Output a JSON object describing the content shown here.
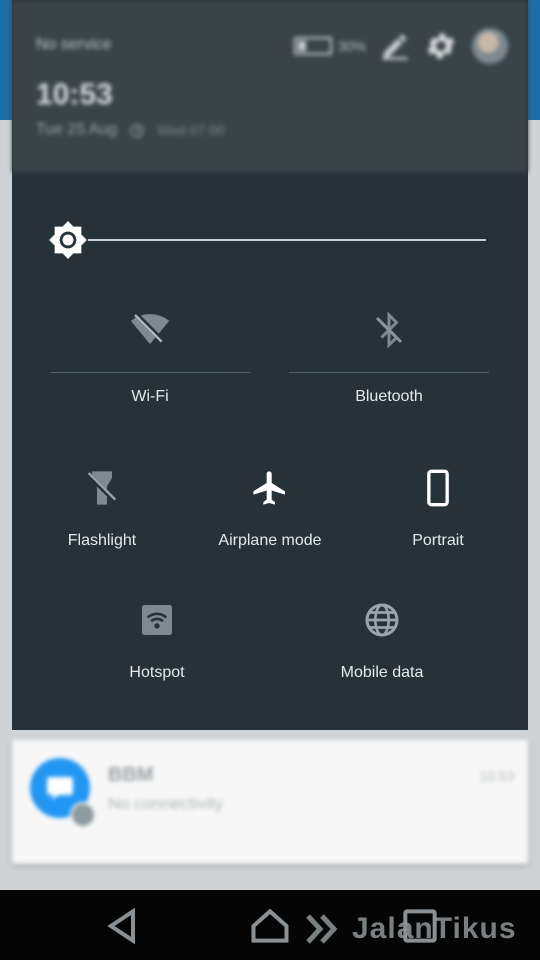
{
  "status_bar": {
    "carrier": "No service",
    "battery_percent": "30%",
    "battery_level": 0.3
  },
  "header": {
    "time": "10:53",
    "date": "Tue 25 Aug",
    "next_alarm": "Wed 07:00"
  },
  "brightness": {
    "level": 0.02
  },
  "quick_settings": {
    "wifi": {
      "label": "Wi-Fi"
    },
    "bluetooth": {
      "label": "Bluetooth"
    },
    "flashlight": {
      "label": "Flashlight"
    },
    "airplane": {
      "label": "Airplane mode"
    },
    "portrait": {
      "label": "Portrait"
    },
    "hotspot": {
      "label": "Hotspot"
    },
    "mobile_data": {
      "label": "Mobile data"
    }
  },
  "notification": {
    "title": "BBM",
    "text": "No connectivity",
    "time": "10:53",
    "icon": "bbm-icon"
  },
  "watermark": {
    "text": "JalanTikus"
  },
  "colors": {
    "shade_bg": "#263238",
    "header_bg": "#3a4448",
    "accent_blue": "#2196f3",
    "label_text": "#e6e9ea"
  }
}
